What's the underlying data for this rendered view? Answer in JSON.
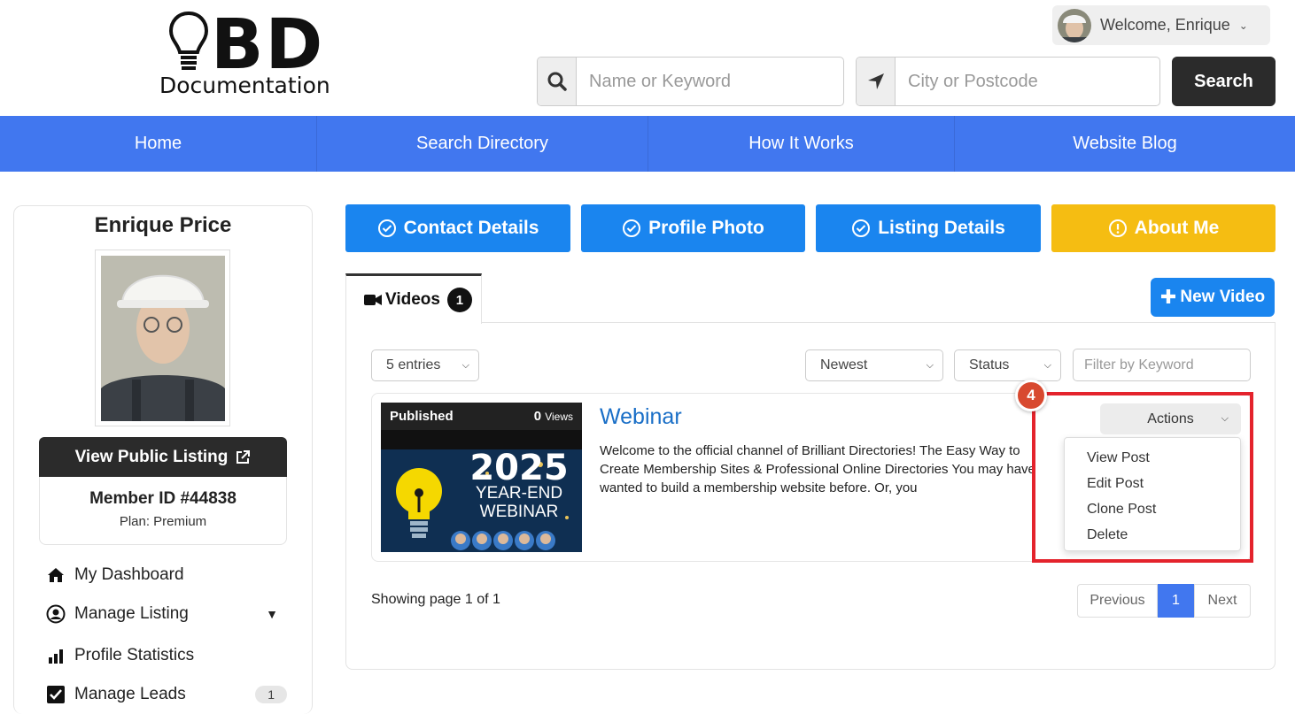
{
  "header": {
    "logo_letters": "BD",
    "logo_word": "Documentation",
    "welcome": "Welcome, Enrique",
    "search_keyword_placeholder": "Name or Keyword",
    "search_city_placeholder": "City or Postcode",
    "search_button": "Search"
  },
  "nav": {
    "items": [
      {
        "label": "Home"
      },
      {
        "label": "Search Directory"
      },
      {
        "label": "How It Works"
      },
      {
        "label": "Website Blog"
      }
    ]
  },
  "sidebar": {
    "name": "Enrique Price",
    "view_public": "View Public Listing",
    "member_id": "Member ID #44838",
    "plan": "Plan: Premium",
    "links": [
      {
        "label": "My Dashboard",
        "icon": "home-icon"
      },
      {
        "label": "Manage Listing",
        "icon": "user-circle-icon"
      },
      {
        "label": "Profile Statistics",
        "icon": "bar-chart-icon"
      },
      {
        "label": "Manage Leads",
        "icon": "checkbox-icon",
        "badge": "1"
      }
    ]
  },
  "steps": [
    {
      "label": "Contact Details",
      "status": "complete",
      "color": "#1a85ef"
    },
    {
      "label": "Profile Photo",
      "status": "complete",
      "color": "#1a85ef"
    },
    {
      "label": "Listing Details",
      "status": "complete",
      "color": "#1a85ef"
    },
    {
      "label": "About Me",
      "status": "warning",
      "color": "#f5bd12"
    }
  ],
  "videos": {
    "tab_label": "Videos",
    "tab_count": "1",
    "new_button": "New Video",
    "entries_select": "5 entries",
    "sort_select": "Newest",
    "status_select": "Status",
    "filter_placeholder": "Filter by Keyword",
    "post": {
      "status": "Published",
      "views_count": "0",
      "views_label": "Views",
      "thumb_year": "2025",
      "thumb_line1": "YEAR-END",
      "thumb_line2": "WEBINAR",
      "title": "Webinar",
      "description": "Welcome to the official channel of Brilliant Directories! The Easy Way to Create Membership Sites & Professional Online Directories You may have wanted to build a membership website before. Or, you"
    },
    "actions_label": "Actions",
    "actions_menu": [
      {
        "label": "View Post"
      },
      {
        "label": "Edit Post"
      },
      {
        "label": "Clone Post"
      },
      {
        "label": "Delete"
      }
    ],
    "step_marker": "4",
    "showing": "Showing page 1 of 1",
    "pager": {
      "previous": "Previous",
      "current": "1",
      "next": "Next"
    }
  },
  "colors": {
    "nav_blue": "#4177ef",
    "step_blue": "#1a85ef",
    "step_yellow": "#f5bd12",
    "highlight_red": "#e4232c"
  }
}
